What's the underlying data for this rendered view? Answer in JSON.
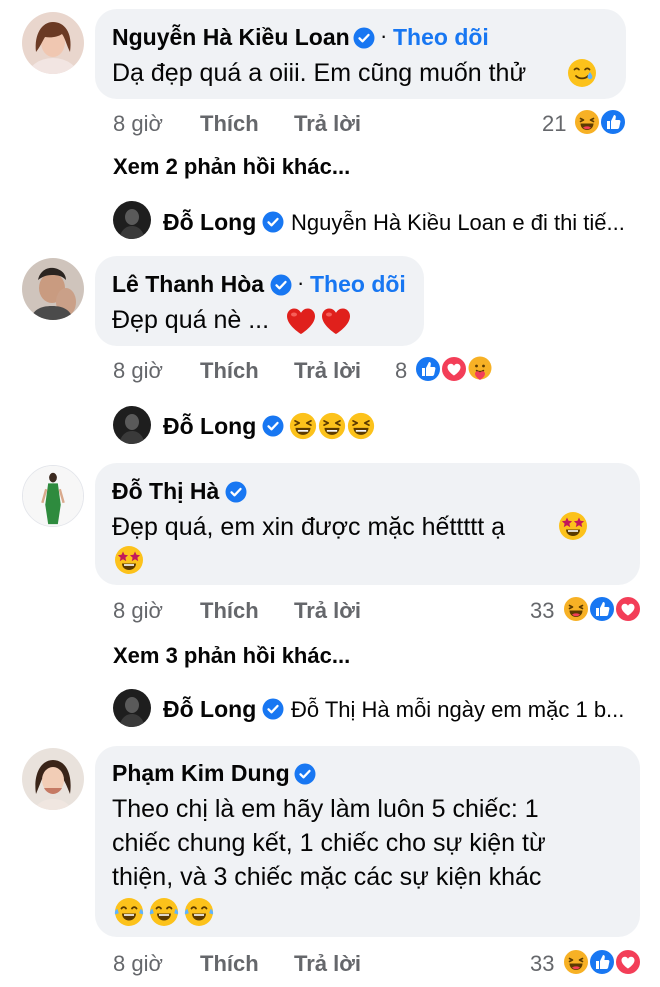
{
  "comments": [
    {
      "author": "Nguyễn Hà Kiều Loan",
      "follow": "Theo dõi",
      "text": "Dạ đẹp quá a oiii. Em cũng muốn thử",
      "time": "8 giờ",
      "like": "Thích",
      "reply": "Trả lời",
      "reaction_count": "21",
      "reactions": [
        "haha-icon",
        "like-icon"
      ],
      "more_replies": "Xem 2 phản hồi khác...",
      "reply_preview": {
        "author": "Đỗ Long",
        "text": "Nguyễn Hà Kiều Loan e đi thi tiế..."
      }
    },
    {
      "author": "Lê Thanh Hòa",
      "follow": "Theo dõi",
      "text": "Đẹp quá nè ...",
      "time": "8 giờ",
      "like": "Thích",
      "reply": "Trả lời",
      "reaction_count": "8",
      "reactions": [
        "like-icon",
        "love-icon",
        "care-icon"
      ],
      "reply_preview": {
        "author": "Đỗ Long",
        "text": ""
      }
    },
    {
      "author": "Đỗ Thị Hà",
      "text": "Đẹp quá, em xin được mặc hếttttt ạ",
      "time": "8 giờ",
      "like": "Thích",
      "reply": "Trả lời",
      "reaction_count": "33",
      "reactions": [
        "haha-icon",
        "like-icon",
        "love-icon"
      ],
      "more_replies": "Xem 3 phản hồi khác...",
      "reply_preview": {
        "author": "Đỗ Long",
        "text": "Đỗ Thị Hà mỗi ngày em mặc 1 b..."
      }
    },
    {
      "author": "Phạm Kim Dung",
      "text_lines": [
        "Theo chị là em hãy làm luôn 5 chiếc: 1",
        "chiếc chung kết, 1 chiếc cho sự kiện từ",
        "thiện, và 3 chiếc mặc các sự kiện khác"
      ],
      "time": "8 giờ",
      "like": "Thích",
      "reply": "Trả lời",
      "reaction_count": "33",
      "reactions": [
        "haha-icon",
        "like-icon",
        "love-icon"
      ]
    }
  ],
  "colors": {
    "accent": "#1877f2",
    "bubble": "#f0f2f5",
    "meta": "#65676b",
    "love": "#f33e58",
    "emoji": "#f7b125"
  }
}
